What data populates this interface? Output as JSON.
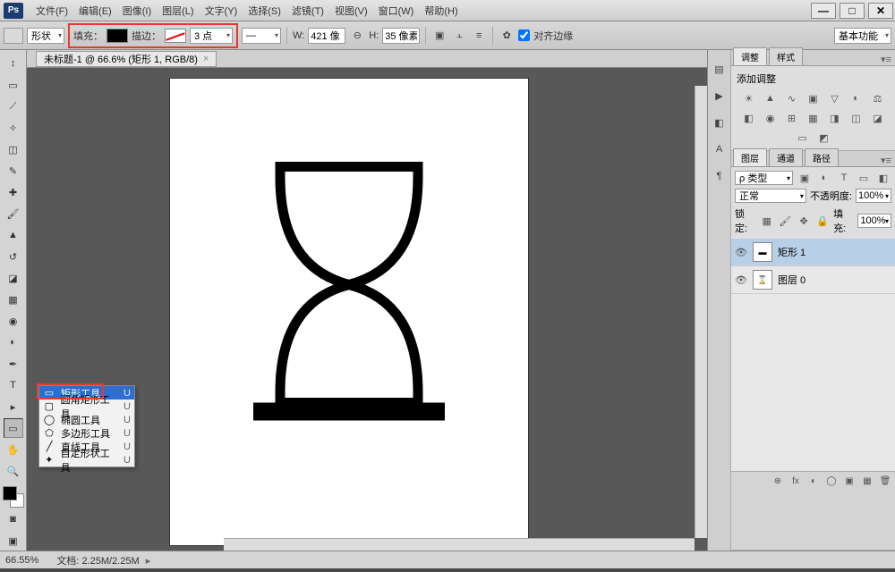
{
  "menu": [
    "文件(F)",
    "编辑(E)",
    "图像(I)",
    "图层(L)",
    "文字(Y)",
    "选择(S)",
    "滤镜(T)",
    "视图(V)",
    "窗口(W)",
    "帮助(H)"
  ],
  "options": {
    "shape_mode": "形状",
    "fill_label": "填充：",
    "stroke_label": "描边：",
    "stroke_width": "3 点",
    "w_label": "W:",
    "w_value": "421 像",
    "link": "⊖",
    "h_label": "H:",
    "h_value": "35 像素",
    "align_label": "对齐边缘",
    "workspace_sel": "基本功能"
  },
  "doc_tab": {
    "title": "未标题-1 @ 66.6% (矩形 1, RGB/8)",
    "close": "×"
  },
  "tool_flyout": {
    "items": [
      {
        "icon": "▭",
        "label": "矩形工具",
        "short": "U"
      },
      {
        "icon": "▢",
        "label": "圆角矩形工具",
        "short": "U"
      },
      {
        "icon": "◯",
        "label": "椭圆工具",
        "short": "U"
      },
      {
        "icon": "⬠",
        "label": "多边形工具",
        "short": "U"
      },
      {
        "icon": "╱",
        "label": "直线工具",
        "short": "U"
      },
      {
        "icon": "✦",
        "label": "自定形状工具",
        "short": "U"
      }
    ]
  },
  "panels": {
    "adjust_tabs": [
      "调整",
      "样式"
    ],
    "adjust_title": "添加调整",
    "layer_tabs": [
      "图层",
      "通道",
      "路径"
    ],
    "kind_label": "ρ 类型",
    "blend_mode": "正常",
    "opacity_label": "不透明度:",
    "opacity_value": "100%",
    "lock_label": "锁定:",
    "fill_lab": "填充:",
    "fill_value": "100%",
    "layers": [
      {
        "name": "矩形 1",
        "thumb": "▬"
      },
      {
        "name": "图层 0",
        "thumb": "⌛"
      }
    ]
  },
  "status": {
    "zoom": "66.55%",
    "doc_label": "文档:",
    "doc_size": "2.25M/2.25M"
  }
}
